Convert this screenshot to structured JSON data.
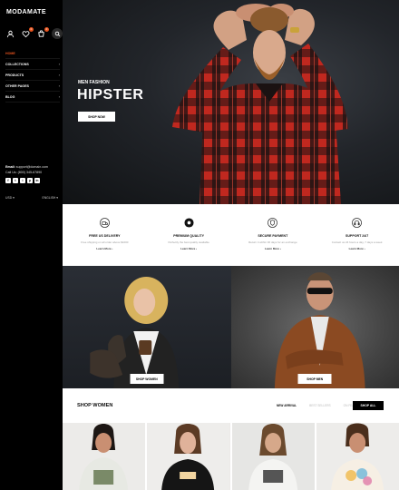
{
  "sidebar": {
    "logo": "MODAMATE",
    "cart_count": "0",
    "wishlist_count": "0",
    "nav": [
      {
        "label": "HOME",
        "active": true,
        "chevron": ""
      },
      {
        "label": "COLLECTIONS",
        "active": false,
        "chevron": "›"
      },
      {
        "label": "PRODUCTS",
        "active": false,
        "chevron": "›"
      },
      {
        "label": "OTHER PAGES",
        "active": false,
        "chevron": "›"
      },
      {
        "label": "BLOG",
        "active": false,
        "chevron": "›"
      }
    ],
    "email_label": "Email:",
    "email": "support@domain.com",
    "phone": "Call Us: (800) 345-67890",
    "socials": [
      "f",
      "t",
      "i",
      "p",
      "in"
    ],
    "currency": "USD",
    "language": "ENGLISH"
  },
  "hero": {
    "eyebrow": "MEN FASHION",
    "title": "HIPSTER",
    "button": "SHOP NOW"
  },
  "features": [
    {
      "icon": "truck-icon",
      "title": "FREE US DELIVERY",
      "desc": "Free shipping on all order above $1000",
      "link": "Learn More ›"
    },
    {
      "icon": "award-icon",
      "title": "PREMIUM QUALITY",
      "desc": "Perfectly the best quality available",
      "link": "Learn More ›"
    },
    {
      "icon": "shield-icon",
      "title": "SECURE PAYMENT",
      "desc": "Return it within 30 days for an exchange",
      "link": "Learn More ›"
    },
    {
      "icon": "headset-icon",
      "title": "SUPPORT 24/7",
      "desc": "Contact us 24 hours a day, 7 days a week",
      "link": "Learn More ›"
    }
  ],
  "banners": {
    "women_button": "SHOP WOMEN",
    "men_button": "SHOP MEN"
  },
  "shop": {
    "heading": "SHOP WOMEN",
    "tabs": [
      {
        "label": "NEW ARRIVAL",
        "active": true
      },
      {
        "label": "BEST SELLERS",
        "active": false
      },
      {
        "label": "ON FEATURED",
        "active": false
      }
    ],
    "button": "SHOP ALL"
  },
  "colors": {
    "accent": "#e8541e",
    "shirt_red": "#c0281f",
    "background": "#000000"
  }
}
